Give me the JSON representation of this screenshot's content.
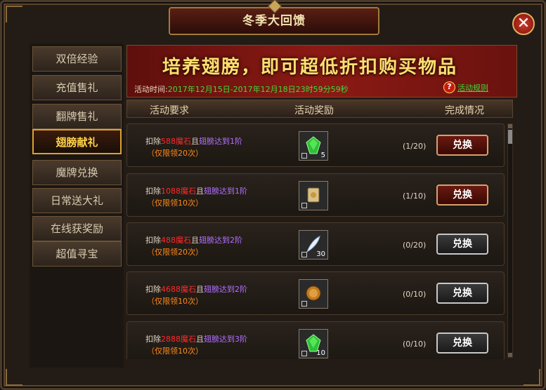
{
  "window": {
    "title": "冬季大回馈",
    "close_glyph": "✕"
  },
  "sidebar": {
    "items": [
      {
        "label": "双倍经验",
        "active": false
      },
      {
        "label": "充值售礼",
        "active": false
      },
      {
        "label": "翻牌售礼",
        "active": false
      },
      {
        "label": "翅膀献礼",
        "active": true
      },
      {
        "label": "魔牌兑换",
        "active": false
      },
      {
        "label": "日常送大礼",
        "active": false
      },
      {
        "label": "在线获奖励",
        "active": false
      },
      {
        "label": "超值寻宝",
        "active": false
      }
    ]
  },
  "banner": {
    "headline": "培养翅膀，即可超低折扣购买物品",
    "time_label": "活动时间:",
    "time_value": "2017年12月15日-2017年12月18日23时59分59秒",
    "rules_link": "活动规则",
    "help_glyph": "?"
  },
  "table": {
    "headers": [
      "活动要求",
      "活动奖励",
      "完成情况"
    ],
    "rows": [
      {
        "pre": "扣除",
        "stone": "588魔石",
        "mid": "且",
        "wing": "翅膀达到1阶",
        "limit": "（仅限领20次）",
        "reward_count": "5",
        "reward_icon": "green-gem-icon",
        "progress": "(1/20)",
        "button": "兑换",
        "enabled": true
      },
      {
        "pre": "扣除",
        "stone": "1088魔石",
        "mid": "且",
        "wing": "翅膀达到1阶",
        "limit": "（仅限领10次）",
        "reward_count": "",
        "reward_icon": "scroll-icon",
        "progress": "(1/10)",
        "button": "兑换",
        "enabled": true
      },
      {
        "pre": "扣除",
        "stone": "488魔石",
        "mid": "且",
        "wing": "翅膀达到2阶",
        "limit": "（仅限领20次）",
        "reward_count": "30",
        "reward_icon": "feather-icon",
        "progress": "(0/20)",
        "button": "兑换",
        "enabled": false
      },
      {
        "pre": "扣除",
        "stone": "4688魔石",
        "mid": "且",
        "wing": "翅膀达到2阶",
        "limit": "（仅限领10次）",
        "reward_count": "",
        "reward_icon": "gold-coin-icon",
        "progress": "(0/10)",
        "button": "兑换",
        "enabled": false
      },
      {
        "pre": "扣除",
        "stone": "2888魔石",
        "mid": "且",
        "wing": "翅膀达到3阶",
        "limit": "（仅限领10次）",
        "reward_count": "10",
        "reward_icon": "green-gem-icon",
        "progress": "(0/10)",
        "button": "兑换",
        "enabled": false
      }
    ]
  },
  "colors": {
    "stone": "#ff2a2a",
    "wing": "#b070ff",
    "limit": "#ff8a1a",
    "time": "#3adc3a",
    "active_tab": "#ffd34a"
  }
}
